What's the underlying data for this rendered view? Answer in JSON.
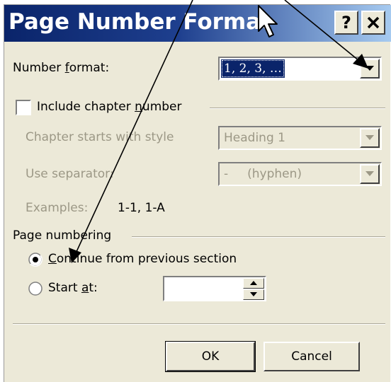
{
  "titlebar": {
    "title": "Page Number Format",
    "help_label": "?",
    "close_label": "✕"
  },
  "number_format": {
    "label_pre": "Number ",
    "label_key": "f",
    "label_post": "ormat:",
    "value": "1, 2, 3, …"
  },
  "chapter": {
    "checkbox_pre": "Include chapter ",
    "checkbox_key": "n",
    "checkbox_post": "umber",
    "checked": false,
    "style_label": "Chapter starts with style",
    "style_value": "Heading 1",
    "separator_label": "Use separator:",
    "separator_value": "-     (hyphen)",
    "examples_label": "Examples:",
    "examples_value": "1-1, 1-A"
  },
  "page_numbering": {
    "group_label": "Page numbering",
    "continue_key": "C",
    "continue_rest": "ontinue from previous section",
    "continue_selected": true,
    "start_pre": "Start ",
    "start_key": "a",
    "start_post": "t:",
    "start_value": ""
  },
  "buttons": {
    "ok": "OK",
    "cancel": "Cancel"
  },
  "colors": {
    "dialog_face": "#ece9d8",
    "title_gradient_start": "#0a246a",
    "selection": "#0a246a",
    "disabled_text": "#9c9886"
  }
}
